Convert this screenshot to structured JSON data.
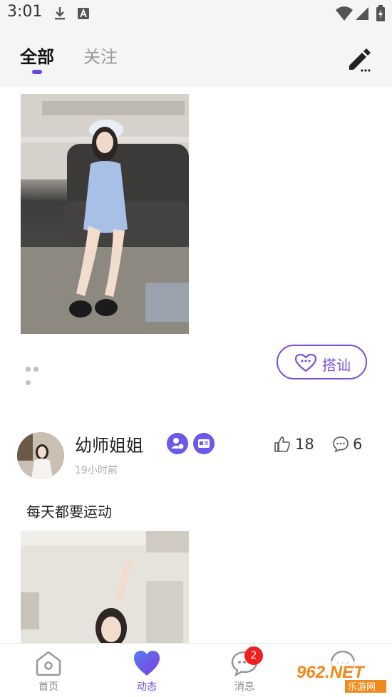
{
  "status_bar": {
    "time": "3:01"
  },
  "header": {
    "tabs": [
      {
        "label": "全部",
        "active": true
      },
      {
        "label": "关注",
        "active": false
      }
    ],
    "accent_color": "#6a45e8"
  },
  "post1": {
    "photo_alt": "girl in light blue dress sitting on sofa",
    "action_label": "搭讪"
  },
  "post2": {
    "username": "幼师姐姐",
    "time_ago": "19小时前",
    "likes": "18",
    "comments": "6",
    "text": "每天都要运动"
  },
  "bottom_nav": {
    "items": [
      {
        "label": "首页",
        "icon": "home-icon"
      },
      {
        "label": "动态",
        "icon": "heart-icon"
      },
      {
        "label": "消息",
        "icon": "message-icon",
        "badge": "2"
      },
      {
        "label": "",
        "icon": "chat-icon"
      }
    ]
  },
  "watermark": {
    "text": "962.NET",
    "subtext": "乐游网"
  }
}
